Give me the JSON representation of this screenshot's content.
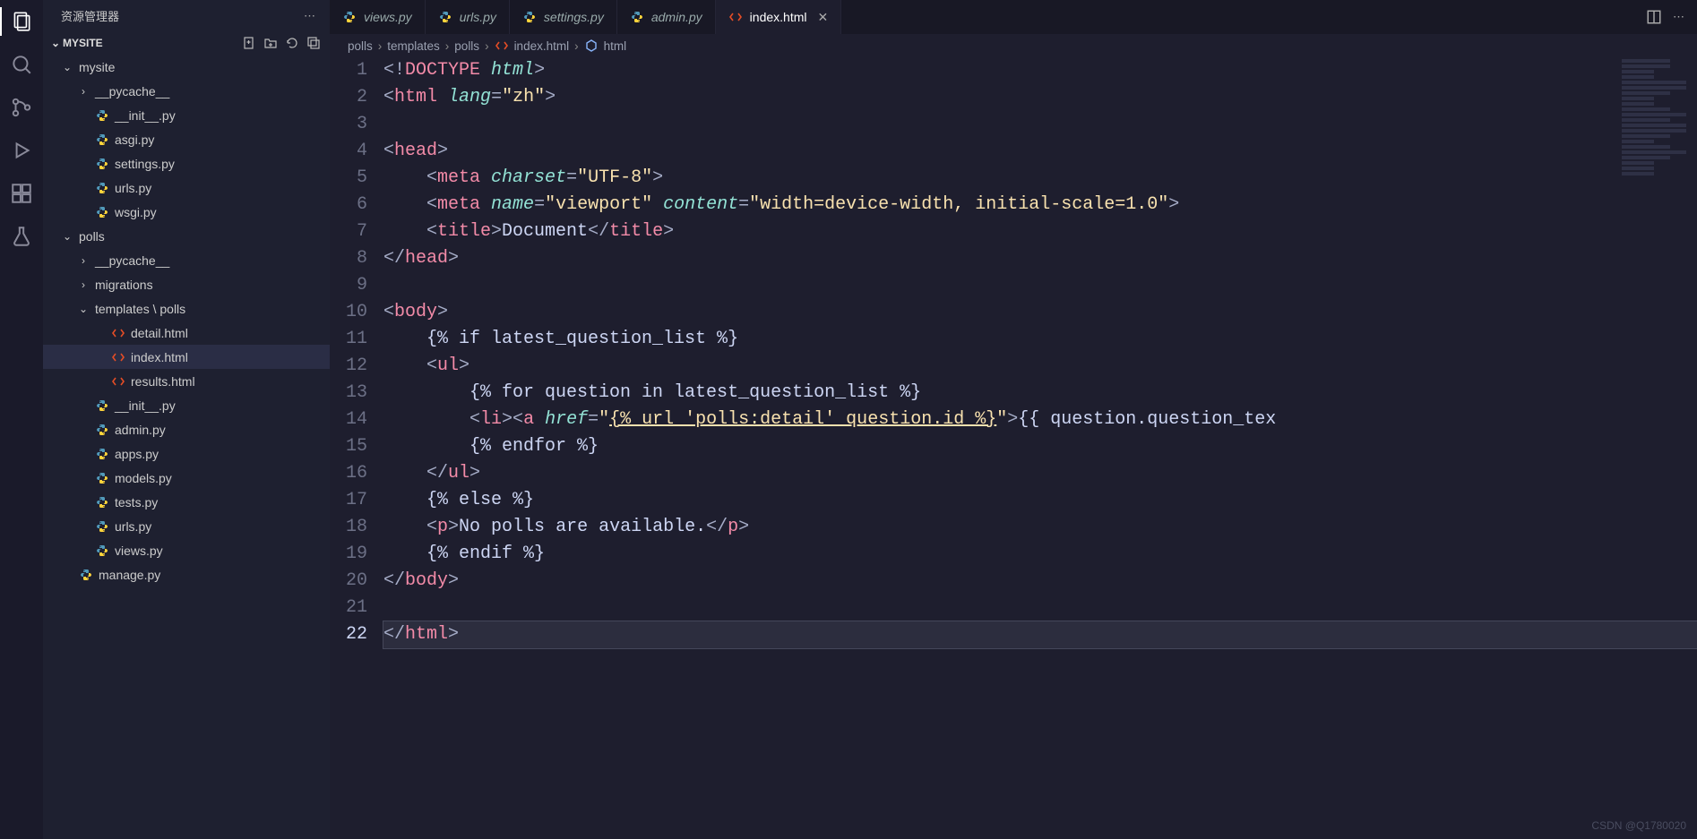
{
  "activity": [
    {
      "name": "explorer-icon",
      "active": true
    },
    {
      "name": "search-icon",
      "active": false
    },
    {
      "name": "source-control-icon",
      "active": false
    },
    {
      "name": "run-debug-icon",
      "active": false
    },
    {
      "name": "extensions-icon",
      "active": false
    },
    {
      "name": "testing-icon",
      "active": false
    }
  ],
  "sidebar": {
    "title": "资源管理器",
    "project": "MYSITE",
    "tree": [
      {
        "depth": 0,
        "type": "folder",
        "name": "mysite",
        "open": true
      },
      {
        "depth": 1,
        "type": "folder",
        "name": "__pycache__",
        "open": false
      },
      {
        "depth": 1,
        "type": "file-py",
        "name": "__init__.py"
      },
      {
        "depth": 1,
        "type": "file-py",
        "name": "asgi.py"
      },
      {
        "depth": 1,
        "type": "file-py",
        "name": "settings.py"
      },
      {
        "depth": 1,
        "type": "file-py",
        "name": "urls.py"
      },
      {
        "depth": 1,
        "type": "file-py",
        "name": "wsgi.py"
      },
      {
        "depth": 0,
        "type": "folder",
        "name": "polls",
        "open": true
      },
      {
        "depth": 1,
        "type": "folder",
        "name": "__pycache__",
        "open": false
      },
      {
        "depth": 1,
        "type": "folder",
        "name": "migrations",
        "open": false
      },
      {
        "depth": 1,
        "type": "folder",
        "name": "templates \\ polls",
        "open": true
      },
      {
        "depth": 2,
        "type": "file-html",
        "name": "detail.html"
      },
      {
        "depth": 2,
        "type": "file-html",
        "name": "index.html",
        "selected": true
      },
      {
        "depth": 2,
        "type": "file-html",
        "name": "results.html"
      },
      {
        "depth": 1,
        "type": "file-py",
        "name": "__init__.py"
      },
      {
        "depth": 1,
        "type": "file-py",
        "name": "admin.py"
      },
      {
        "depth": 1,
        "type": "file-py",
        "name": "apps.py"
      },
      {
        "depth": 1,
        "type": "file-py",
        "name": "models.py"
      },
      {
        "depth": 1,
        "type": "file-py",
        "name": "tests.py"
      },
      {
        "depth": 1,
        "type": "file-py",
        "name": "urls.py"
      },
      {
        "depth": 1,
        "type": "file-py",
        "name": "views.py"
      },
      {
        "depth": 0,
        "type": "file-py",
        "name": "manage.py"
      }
    ]
  },
  "tabs": [
    {
      "type": "py",
      "name": "views.py",
      "active": false,
      "italic": true
    },
    {
      "type": "py",
      "name": "urls.py",
      "active": false,
      "italic": true
    },
    {
      "type": "py",
      "name": "settings.py",
      "active": false,
      "italic": true
    },
    {
      "type": "py",
      "name": "admin.py",
      "active": false,
      "italic": true
    },
    {
      "type": "html",
      "name": "index.html",
      "active": true,
      "italic": false,
      "close": true
    }
  ],
  "breadcrumb": [
    "polls",
    "templates",
    "polls",
    "index.html",
    "html"
  ],
  "code": {
    "lines": 22,
    "current": 22,
    "content": [
      [
        {
          "t": "<!",
          "c": "punc"
        },
        {
          "t": "DOCTYPE",
          "c": "doctype"
        },
        {
          "t": " ",
          "c": "punc"
        },
        {
          "t": "html",
          "c": "attr"
        },
        {
          "t": ">",
          "c": "punc"
        }
      ],
      [
        {
          "t": "<",
          "c": "punc"
        },
        {
          "t": "html",
          "c": "tag"
        },
        {
          "t": " ",
          "c": "punc"
        },
        {
          "t": "lang",
          "c": "attr"
        },
        {
          "t": "=",
          "c": "punc"
        },
        {
          "t": "\"zh\"",
          "c": "str"
        },
        {
          "t": ">",
          "c": "punc"
        }
      ],
      [],
      [
        {
          "t": "<",
          "c": "punc"
        },
        {
          "t": "head",
          "c": "tag"
        },
        {
          "t": ">",
          "c": "punc"
        }
      ],
      [
        {
          "t": "    <",
          "c": "punc"
        },
        {
          "t": "meta",
          "c": "tag"
        },
        {
          "t": " ",
          "c": "punc"
        },
        {
          "t": "charset",
          "c": "attr"
        },
        {
          "t": "=",
          "c": "punc"
        },
        {
          "t": "\"UTF-8\"",
          "c": "str"
        },
        {
          "t": ">",
          "c": "punc"
        }
      ],
      [
        {
          "t": "    <",
          "c": "punc"
        },
        {
          "t": "meta",
          "c": "tag"
        },
        {
          "t": " ",
          "c": "punc"
        },
        {
          "t": "name",
          "c": "attr"
        },
        {
          "t": "=",
          "c": "punc"
        },
        {
          "t": "\"viewport\"",
          "c": "str"
        },
        {
          "t": " ",
          "c": "punc"
        },
        {
          "t": "content",
          "c": "attr"
        },
        {
          "t": "=",
          "c": "punc"
        },
        {
          "t": "\"width=device-width, initial-scale=1.0\"",
          "c": "str"
        },
        {
          "t": ">",
          "c": "punc"
        }
      ],
      [
        {
          "t": "    <",
          "c": "punc"
        },
        {
          "t": "title",
          "c": "tag"
        },
        {
          "t": ">",
          "c": "punc"
        },
        {
          "t": "Document",
          "c": "text"
        },
        {
          "t": "</",
          "c": "punc"
        },
        {
          "t": "title",
          "c": "tag"
        },
        {
          "t": ">",
          "c": "punc"
        }
      ],
      [
        {
          "t": "</",
          "c": "punc"
        },
        {
          "t": "head",
          "c": "tag"
        },
        {
          "t": ">",
          "c": "punc"
        }
      ],
      [],
      [
        {
          "t": "<",
          "c": "punc"
        },
        {
          "t": "body",
          "c": "tag"
        },
        {
          "t": ">",
          "c": "punc"
        }
      ],
      [
        {
          "t": "    {% if latest_question_list %}",
          "c": "white"
        }
      ],
      [
        {
          "t": "    <",
          "c": "punc"
        },
        {
          "t": "ul",
          "c": "tag"
        },
        {
          "t": ">",
          "c": "punc"
        }
      ],
      [
        {
          "t": "        {% for question in latest_question_list %}",
          "c": "white"
        }
      ],
      [
        {
          "t": "        <",
          "c": "punc"
        },
        {
          "t": "li",
          "c": "tag"
        },
        {
          "t": "><",
          "c": "punc"
        },
        {
          "t": "a",
          "c": "tag"
        },
        {
          "t": " ",
          "c": "punc"
        },
        {
          "t": "href",
          "c": "attr"
        },
        {
          "t": "=",
          "c": "punc"
        },
        {
          "t": "\"",
          "c": "str"
        },
        {
          "t": "{% url 'polls:detail' question.id %}",
          "c": "str-url"
        },
        {
          "t": "\"",
          "c": "str"
        },
        {
          "t": ">",
          "c": "punc"
        },
        {
          "t": "{{ question.question_tex",
          "c": "white"
        }
      ],
      [
        {
          "t": "        {% endfor %}",
          "c": "white"
        }
      ],
      [
        {
          "t": "    </",
          "c": "punc"
        },
        {
          "t": "ul",
          "c": "tag"
        },
        {
          "t": ">",
          "c": "punc"
        }
      ],
      [
        {
          "t": "    {% else %}",
          "c": "white"
        }
      ],
      [
        {
          "t": "    <",
          "c": "punc"
        },
        {
          "t": "p",
          "c": "tag"
        },
        {
          "t": ">",
          "c": "punc"
        },
        {
          "t": "No polls are available.",
          "c": "text"
        },
        {
          "t": "</",
          "c": "punc"
        },
        {
          "t": "p",
          "c": "tag"
        },
        {
          "t": ">",
          "c": "punc"
        }
      ],
      [
        {
          "t": "    {% endif %}",
          "c": "white"
        }
      ],
      [
        {
          "t": "</",
          "c": "punc"
        },
        {
          "t": "body",
          "c": "tag"
        },
        {
          "t": ">",
          "c": "punc"
        }
      ],
      [],
      [
        {
          "t": "</",
          "c": "punc"
        },
        {
          "t": "html",
          "c": "tag"
        },
        {
          "t": ">",
          "c": "punc"
        }
      ]
    ]
  },
  "watermark": "CSDN @Q1780020"
}
